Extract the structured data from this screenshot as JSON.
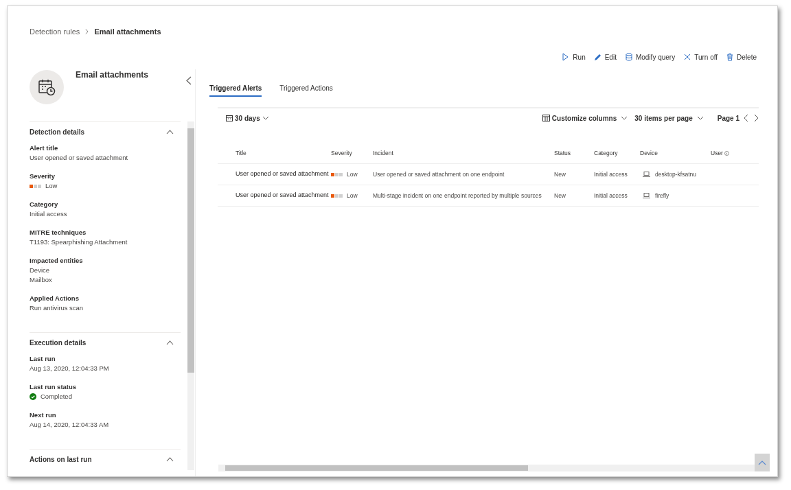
{
  "breadcrumb": [
    {
      "label": "Detection rules",
      "current": false
    },
    {
      "label": "Email attachments",
      "current": true
    }
  ],
  "actions": [
    {
      "kind": "run",
      "label": "Run"
    },
    {
      "kind": "edit",
      "label": "Edit"
    },
    {
      "kind": "query",
      "label": "Modify query"
    },
    {
      "kind": "off",
      "label": "Turn off"
    },
    {
      "kind": "delete",
      "label": "Delete"
    }
  ],
  "rule": {
    "title": "Email attachments"
  },
  "sections": [
    {
      "title": "Detection details",
      "expanded": true,
      "fields": [
        {
          "label": "Alert title",
          "kind": "text",
          "values": [
            "User opened or saved attachment"
          ]
        },
        {
          "label": "Severity",
          "kind": "severity",
          "level": 0.33,
          "values": [
            "Low"
          ]
        },
        {
          "label": "Category",
          "kind": "text",
          "values": [
            "Initial access"
          ]
        },
        {
          "label": "MITRE techniques",
          "kind": "text",
          "values": [
            "T1193: Spearphishing Attachment"
          ]
        },
        {
          "label": "Impacted entities",
          "kind": "text",
          "values": [
            "Device",
            "Mailbox"
          ]
        },
        {
          "label": "Applied Actions",
          "kind": "text",
          "values": [
            "Run antivirus scan"
          ]
        }
      ]
    },
    {
      "title": "Execution details",
      "expanded": true,
      "fields": [
        {
          "label": "Last run",
          "kind": "text",
          "values": [
            "Aug 13, 2020, 12:04:33 PM"
          ]
        },
        {
          "label": "Last run status",
          "kind": "status",
          "values": [
            "Completed"
          ]
        },
        {
          "label": "Next run",
          "kind": "text",
          "values": [
            "Aug 14, 2020, 12:04:33 AM"
          ]
        }
      ]
    },
    {
      "title": "Actions on last run",
      "expanded": true
    }
  ],
  "tabs": [
    {
      "label": "Triggered Alerts",
      "selected": true
    },
    {
      "label": "Triggered Actions",
      "selected": false
    }
  ],
  "filters": {
    "range": "30 days",
    "customize": "Customize columns",
    "per_page": "30 items per page",
    "page": "Page 1"
  },
  "table": {
    "columns": [
      "Title",
      "Severity",
      "Incident",
      "Status",
      "Category",
      "Device",
      "User"
    ],
    "rows": [
      {
        "title": "User opened or saved attachment",
        "severity": "Low",
        "level": 0.33,
        "incident": "User opened or saved attachment on one endpoint",
        "status": "New",
        "category": "Initial access",
        "device": "desktop-kfsatnu"
      },
      {
        "title": "User opened or saved attachment",
        "severity": "Low",
        "level": 0.33,
        "incident": "Multi-stage incident on one endpoint reported by multiple sources",
        "status": "New",
        "category": "Initial access",
        "device": "firefly"
      }
    ]
  }
}
